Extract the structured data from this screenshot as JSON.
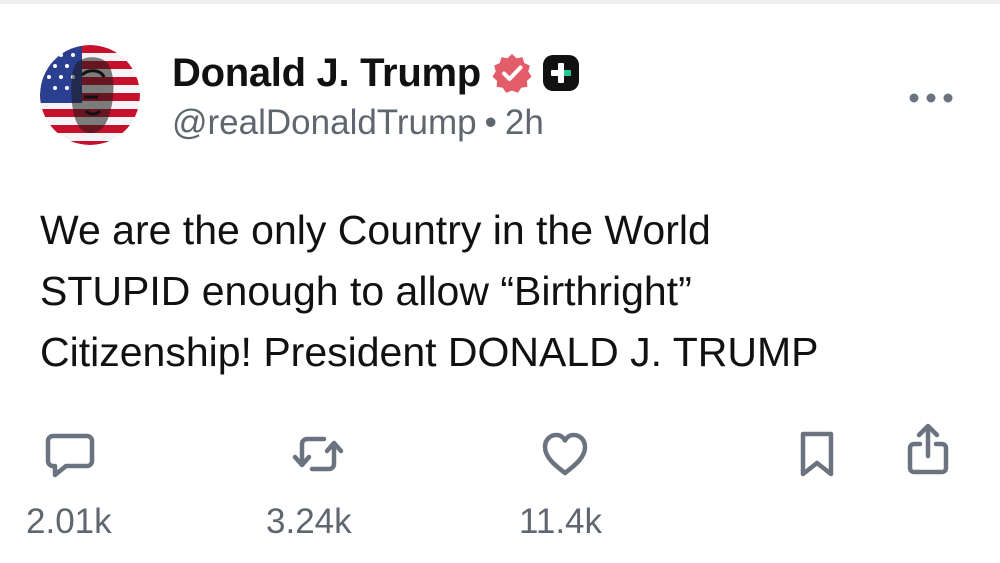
{
  "post": {
    "author": {
      "display_name": "Donald J. Trump",
      "handle": "@realDonaldTrump",
      "separator": "•",
      "timestamp": "2h"
    },
    "body_lines": [
      "We are the only Country in the World",
      "STUPID enough to allow “Birthright”",
      "Citizenship! President DONALD J. TRUMP"
    ],
    "actions": {
      "reply": {
        "icon": "reply-icon",
        "count": "2.01k"
      },
      "retruth": {
        "icon": "retruth-icon",
        "count": "3.24k"
      },
      "like": {
        "icon": "heart-icon",
        "count": "11.4k"
      },
      "bookmark": {
        "icon": "bookmark-icon"
      },
      "share": {
        "icon": "share-icon"
      }
    },
    "icons": {
      "verified": "verified-badge-icon",
      "plus": "plus-badge-icon",
      "more": "more-options-icon"
    }
  },
  "colors": {
    "text_primary": "#111111",
    "text_secondary": "#5f6670",
    "verified_badge": "#e25c6a",
    "plus_badge": "#111111",
    "plus_badge_accent": "#20c997"
  }
}
